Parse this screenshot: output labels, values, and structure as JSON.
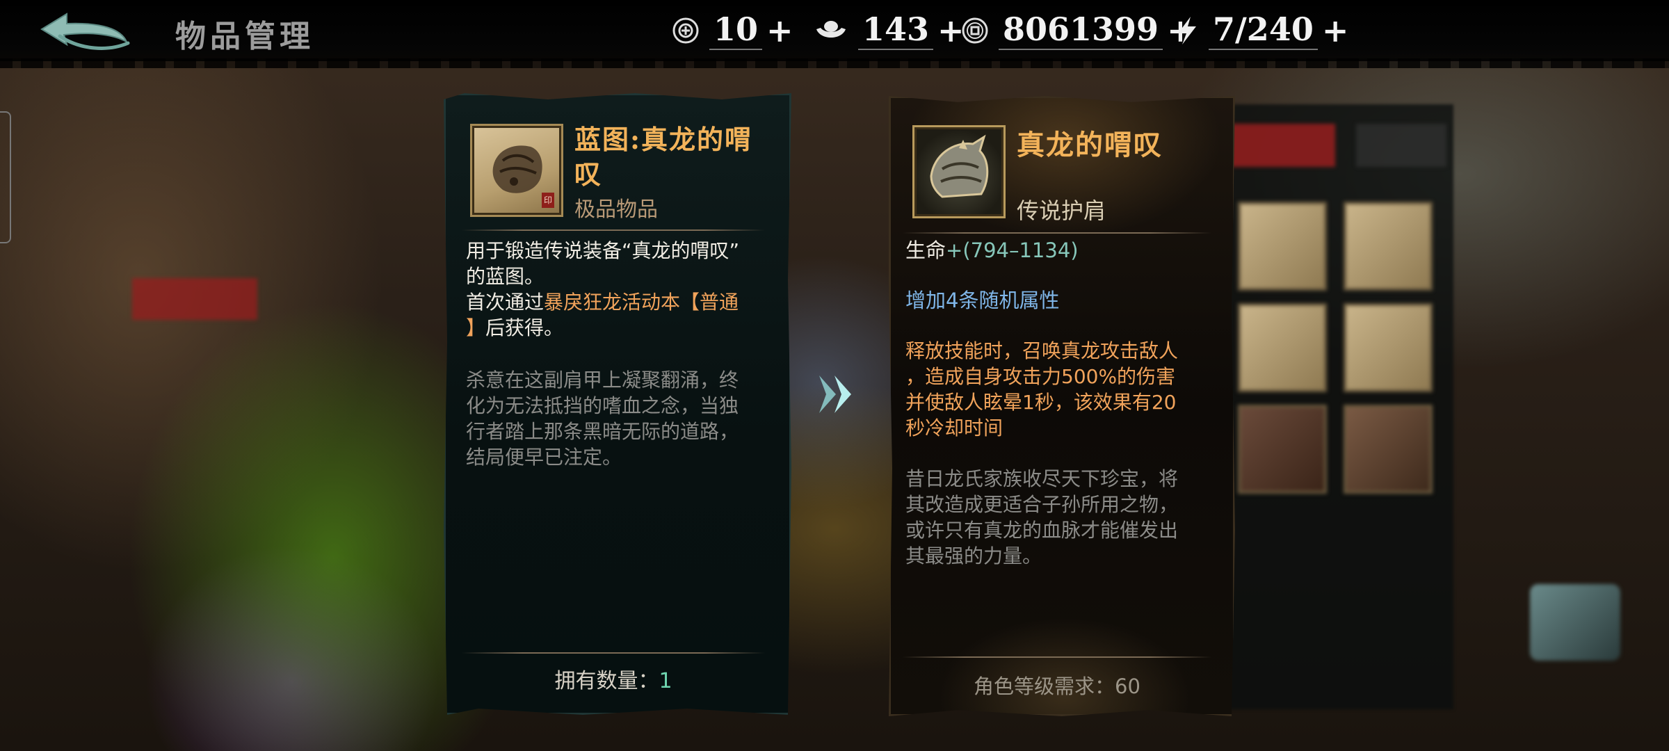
{
  "header": {
    "title": "物品管理",
    "resources": [
      {
        "icon": "coin-token-icon",
        "value": "10 ",
        "plus": "+"
      },
      {
        "icon": "silver-ingot-icon",
        "value": "143",
        "plus": "+"
      },
      {
        "icon": "copper-coin-icon",
        "value": "8061399",
        "plus": "+"
      },
      {
        "icon": "energy-bolt-icon",
        "value": "7/240",
        "plus": "+"
      }
    ]
  },
  "left_card": {
    "title": "蓝图:真龙的喟叹",
    "rarity": "极品物品",
    "desc": {
      "l1": "用于锻造传说装备“真龙的喟叹”",
      "l2": "的蓝图。",
      "l3_a": "首次通过",
      "l3_b": "暴戾狂龙活动本【普通",
      "l4_a": "】",
      "l4_b": "后获得。"
    },
    "lore": [
      "杀意在这副肩甲上凝聚翻涌，终",
      "化为无法抵挡的嗜血之念，当独",
      "行者踏上那条黑暗无际的道路，",
      "结局便早已注定。"
    ],
    "qty_label": "拥有数量：",
    "qty_value": "1"
  },
  "right_card": {
    "title": "真龙的喟叹",
    "type": "传说护肩",
    "stat_label": "生命",
    "stat_value": "+(794–1134)",
    "bonus": "增加4条随机属性",
    "skill": [
      "释放技能时，召唤真龙攻击敌人",
      "，造成自身攻击力500%的伤害",
      "并使敌人眩晕1秒，该效果有20",
      "秒冷却时间"
    ],
    "lore": [
      "昔日龙氏家族收尽天下珍宝，将",
      "其改造成更适合子孙所用之物，",
      "或许只有真龙的血脉才能催发出",
      "其最强的力量。"
    ],
    "level_req": "角色等级需求：60"
  },
  "colors": {
    "title_gold": "#f3b35a",
    "highlight_orange": "#f1a35b",
    "attr_blue": "#7fb6e8",
    "qty_green": "#6fd6b0",
    "tab_red": "#961e1e"
  }
}
